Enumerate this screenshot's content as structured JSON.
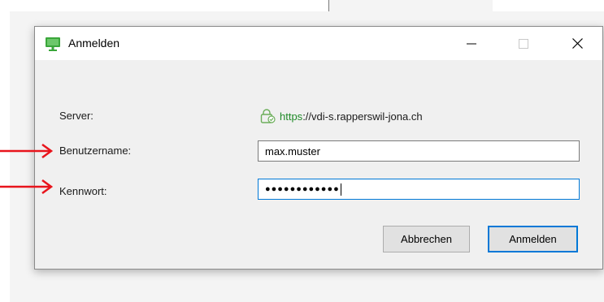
{
  "dialog": {
    "title": "Anmelden",
    "app_icon": "monitor-icon",
    "window_controls": {
      "minimize_icon": "minimize-icon",
      "maximize_icon": "maximize-icon",
      "close_icon": "close-icon"
    }
  },
  "form": {
    "server_label": "Server:",
    "server_protocol": "https",
    "server_rest": "://vdi-s.rapperswil-jona.ch",
    "server_icon": "lock-icon",
    "username_label": "Benutzername:",
    "username_value": "max.muster",
    "password_label": "Kennwort:",
    "password_mask": "●●●●●●●●●●●●"
  },
  "buttons": {
    "cancel_label": "Abbrechen",
    "login_label": "Anmelden"
  },
  "annotations": {
    "arrow_icon": "arrow-right-icon",
    "arrow_color": "#e8141c"
  },
  "colors": {
    "accent": "#0078d7",
    "secure_protocol": "#1f8a28",
    "app_icon": "#3aa63a"
  }
}
